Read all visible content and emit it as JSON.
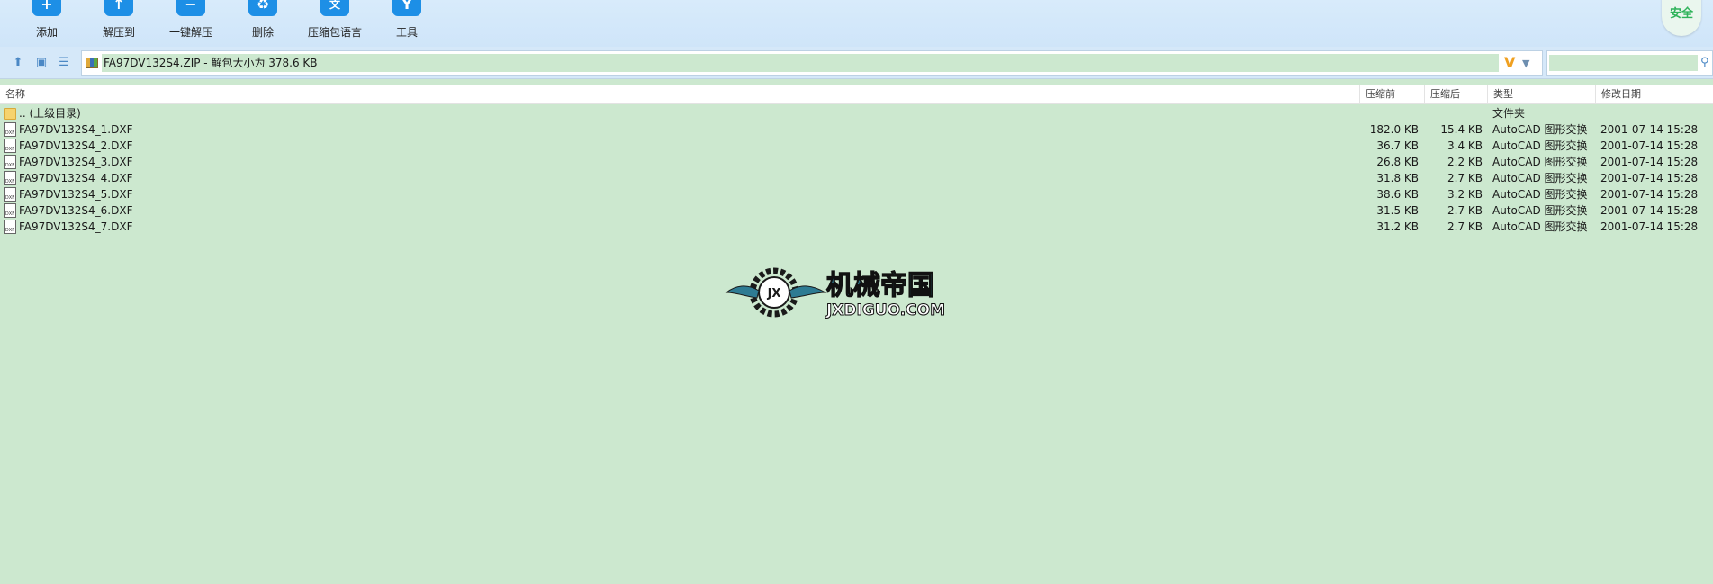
{
  "toolbar": {
    "add": "添加",
    "extract_to": "解压到",
    "one_click_extract": "一键解压",
    "delete": "删除",
    "language_pack": "压缩包语言",
    "tools": "工具",
    "language_icon_text": "文",
    "secure": "安全"
  },
  "address": {
    "path": "FA97DV132S4.ZIP - 解包大小为 378.6 KB",
    "search_placeholder": ""
  },
  "columns": {
    "name": "名称",
    "before": "压缩前",
    "after": "压缩后",
    "type": "类型",
    "date": "修改日期"
  },
  "files": [
    {
      "name": ".. (上级目录)",
      "before": "",
      "after": "",
      "type": "文件夹",
      "date": "",
      "icon": "folder-icon"
    },
    {
      "name": "FA97DV132S4_1.DXF",
      "before": "182.0 KB",
      "after": "15.4 KB",
      "type": "AutoCAD 图形交换",
      "date": "2001-07-14 15:28",
      "icon": "dxf-file-icon"
    },
    {
      "name": "FA97DV132S4_2.DXF",
      "before": "36.7 KB",
      "after": "3.4 KB",
      "type": "AutoCAD 图形交换",
      "date": "2001-07-14 15:28",
      "icon": "dxf-file-icon"
    },
    {
      "name": "FA97DV132S4_3.DXF",
      "before": "26.8 KB",
      "after": "2.2 KB",
      "type": "AutoCAD 图形交换",
      "date": "2001-07-14 15:28",
      "icon": "dxf-file-icon"
    },
    {
      "name": "FA97DV132S4_4.DXF",
      "before": "31.8 KB",
      "after": "2.7 KB",
      "type": "AutoCAD 图形交换",
      "date": "2001-07-14 15:28",
      "icon": "dxf-file-icon"
    },
    {
      "name": "FA97DV132S4_5.DXF",
      "before": "38.6 KB",
      "after": "3.2 KB",
      "type": "AutoCAD 图形交换",
      "date": "2001-07-14 15:28",
      "icon": "dxf-file-icon"
    },
    {
      "name": "FA97DV132S4_6.DXF",
      "before": "31.5 KB",
      "after": "2.7 KB",
      "type": "AutoCAD 图形交换",
      "date": "2001-07-14 15:28",
      "icon": "dxf-file-icon"
    },
    {
      "name": "FA97DV132S4_7.DXF",
      "before": "31.2 KB",
      "after": "2.7 KB",
      "type": "AutoCAD 图形交换",
      "date": "2001-07-14 15:28",
      "icon": "dxf-file-icon"
    }
  ],
  "watermark": {
    "title": "机械帝国",
    "subtitle": "JXDIGUO.COM",
    "badge": "JX"
  },
  "colors": {
    "accent": "#1d8fe6",
    "background": "#cce8cf",
    "secure": "#2fb35a",
    "logo": "#2e7b93"
  }
}
